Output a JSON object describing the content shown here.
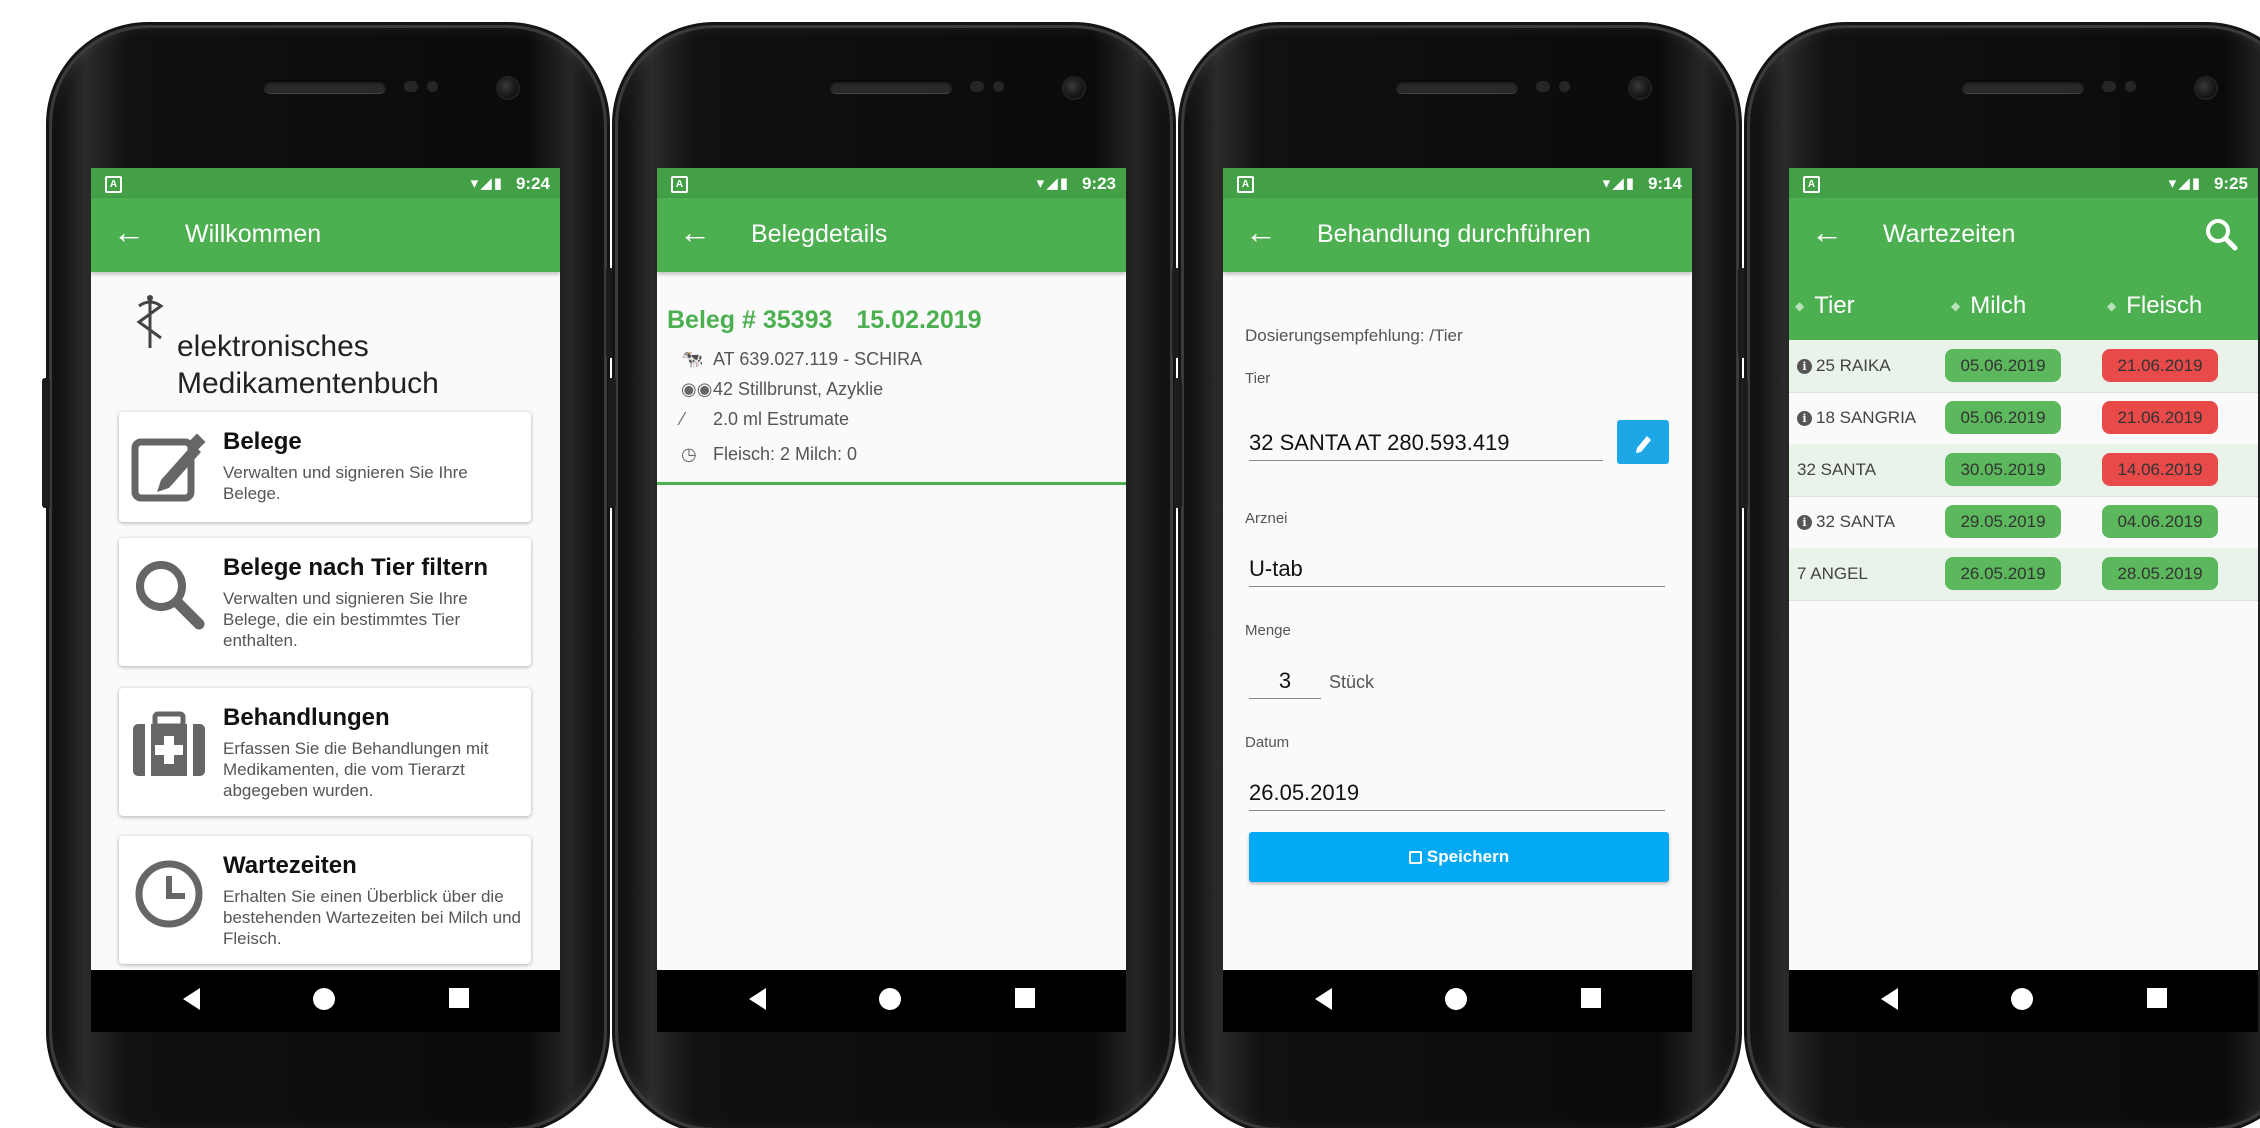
{
  "colors": {
    "primary": "#4caf50",
    "status_bar": "#43a047",
    "accent_blue": "#03a9f4",
    "pill_green": "#5cb85c",
    "pill_red": "#e84a4a"
  },
  "phones": [
    {
      "status_time": "9:24",
      "appbar_title": "Willkommen",
      "header_title": "elektronisches Medikamentenbuch",
      "cards": [
        {
          "icon": "edit-icon",
          "title": "Belege",
          "description": "Verwalten und signieren Sie Ihre Belege."
        },
        {
          "icon": "search-icon",
          "title": "Belege nach Tier filtern",
          "description": "Verwalten und signieren Sie Ihre Belege, die ein bestimmtes Tier enthalten."
        },
        {
          "icon": "medkit-icon",
          "title": "Behandlungen",
          "description": "Erfassen Sie die Behandlungen mit Medikamenten, die vom Tierarzt abgegeben wurden."
        },
        {
          "icon": "clock-icon",
          "title": "Wartezeiten",
          "description": "Erhalten Sie einen Überblick über die bestehenden Wartezeiten bei Milch und Fleisch."
        }
      ]
    },
    {
      "status_time": "9:23",
      "appbar_title": "Belegdetails",
      "beleg_number": "Beleg # 35393",
      "beleg_date": "15.02.2019",
      "details": [
        {
          "icon": "cow-icon",
          "text": "AT 639.027.119 - SCHIRA"
        },
        {
          "icon": "binoculars-icon",
          "text": "42 Stillbrunst, Azyklie"
        },
        {
          "icon": "syringe-icon",
          "text": "2.0 ml Estrumate"
        },
        {
          "icon": "clock-icon",
          "text": "Fleisch: 2  Milch: 0"
        }
      ]
    },
    {
      "status_time": "9:14",
      "appbar_title": "Behandlung durchführen",
      "dosage_hint": "Dosierungsempfehlung: /Tier",
      "tier_label": "Tier",
      "tier_value": "32  SANTA  AT 280.593.419",
      "arznei_label": "Arznei",
      "arznei_value": "U-tab",
      "menge_label": "Menge",
      "menge_value": "3",
      "menge_unit": "Stück",
      "datum_label": "Datum",
      "datum_value": "26.05.2019",
      "save_label": "Speichern"
    },
    {
      "status_time": "9:25",
      "appbar_title": "Wartezeiten",
      "columns": [
        "Tier",
        "Milch",
        "Fleisch"
      ],
      "rows": [
        {
          "info": true,
          "tier": "25 RAIKA",
          "milch": "05.06.2019",
          "milch_status": "green",
          "fleisch": "21.06.2019",
          "fleisch_status": "red"
        },
        {
          "info": true,
          "tier": "18 SANGRIA",
          "milch": "05.06.2019",
          "milch_status": "green",
          "fleisch": "21.06.2019",
          "fleisch_status": "red"
        },
        {
          "info": false,
          "tier": "32 SANTA",
          "milch": "30.05.2019",
          "milch_status": "green",
          "fleisch": "14.06.2019",
          "fleisch_status": "red"
        },
        {
          "info": true,
          "tier": "32 SANTA",
          "milch": "29.05.2019",
          "milch_status": "green",
          "fleisch": "04.06.2019",
          "fleisch_status": "green"
        },
        {
          "info": false,
          "tier": "7 ANGEL",
          "milch": "26.05.2019",
          "milch_status": "green",
          "fleisch": "28.05.2019",
          "fleisch_status": "green"
        }
      ]
    }
  ]
}
